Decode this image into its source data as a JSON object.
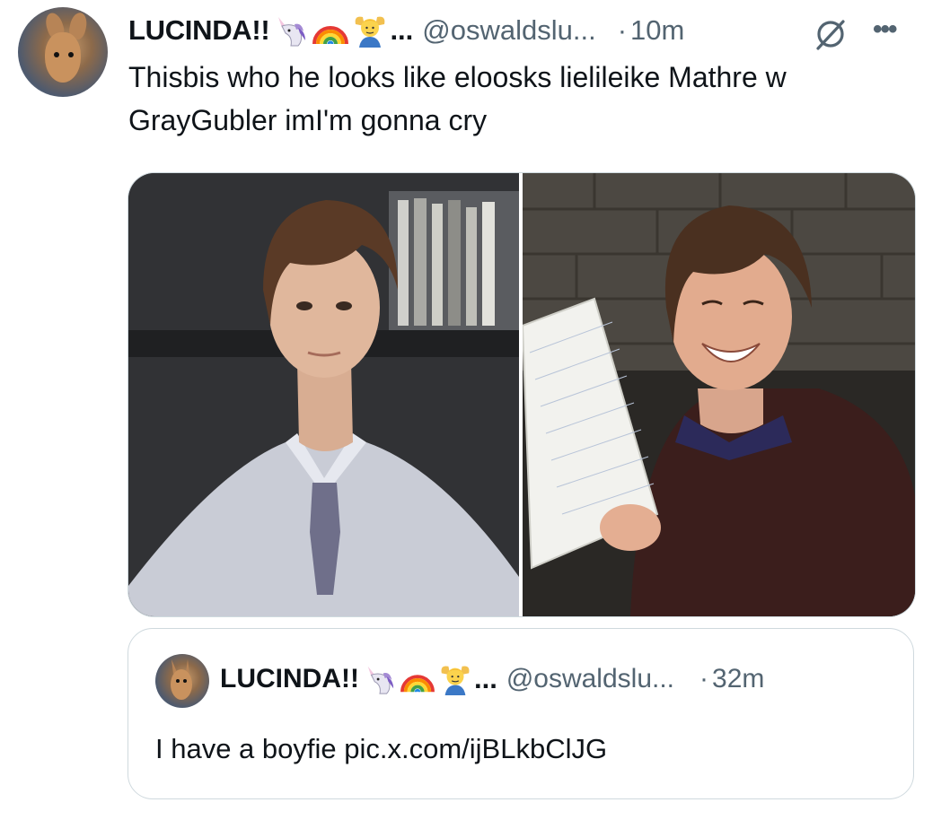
{
  "tweet": {
    "display_name": "LUCINDA!!",
    "emojis": [
      "unicorn-emoji",
      "rainbow-emoji",
      "person-gesturing-ok-emoji"
    ],
    "ellipsis": "...",
    "handle": "@oswaldslu...",
    "separator": "·",
    "time": "10m",
    "more": "•••",
    "text": "Thisbis who he looks like eloosks lielileike Mathre w GrayGubler imI'm gonna cry",
    "media": [
      {
        "label": "photo-man-office-tie"
      },
      {
        "label": "photo-man-smiling-holding-paper"
      }
    ]
  },
  "quoted": {
    "display_name": "LUCINDA!!",
    "ellipsis": "...",
    "handle": "@oswaldslu...",
    "separator": "·",
    "time": "32m",
    "text": "I have a boyfie pic.x.com/ijBLkbClJG"
  },
  "colors": {
    "primary_text": "#0f1419",
    "secondary_text": "#536471",
    "border": "#cfd9de"
  }
}
